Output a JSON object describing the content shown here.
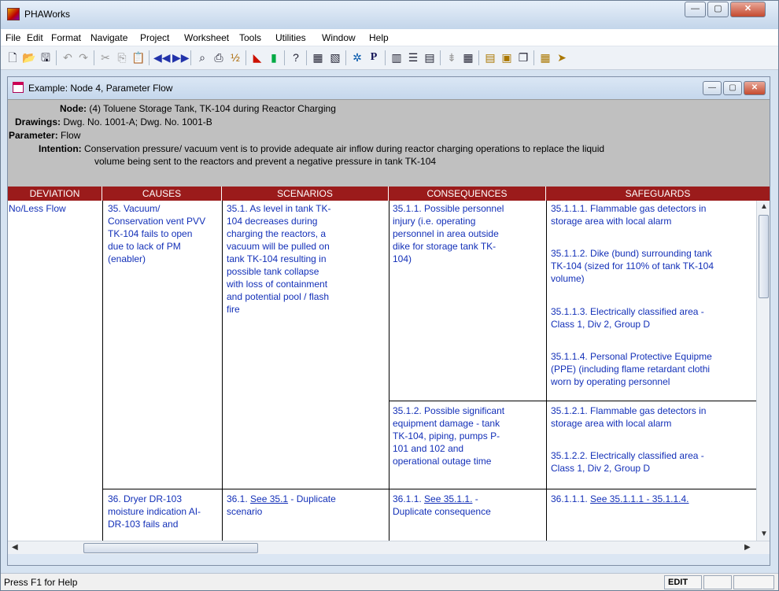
{
  "app": {
    "title": "PHAWorks",
    "min": "—",
    "max": "▢",
    "close": "✕"
  },
  "menu": [
    "File",
    "Edit",
    "Format",
    "Navigate",
    "Project",
    "Worksheet",
    "Tools",
    "Utilities",
    "Window",
    "Help"
  ],
  "toolbar_icons": [
    "new-icon",
    "open-icon",
    "save-icon",
    "undo-icon",
    "redo-icon",
    "cut-icon",
    "copy-icon",
    "paste-icon",
    "first-icon",
    "last-icon",
    "find-icon",
    "print-icon",
    "spell-icon",
    "chart-icon",
    "bars-icon",
    "help-icon"
  ],
  "window": {
    "title": "Example: Node 4, Parameter Flow",
    "min": "—",
    "max": "▢",
    "close": "✕"
  },
  "header": {
    "node_label": "Node:",
    "node_value": "(4) Toluene Storage Tank, TK-104 during Reactor Charging",
    "drawings_label": "Drawings:",
    "drawings_value": "Dwg. No. 1001-A; Dwg. No. 1001-B",
    "parameter_label": "Parameter:",
    "parameter_value": "Flow",
    "intention_label": "Intention:",
    "intention_line1": "Conservation pressure/ vacuum vent is to provide adequate air inflow during reactor charging operations to replace the liquid",
    "intention_line2": "volume being sent to the reactors and prevent a negative pressure in tank TK-104"
  },
  "columns": [
    "DEVIATION",
    "CAUSES",
    "SCENARIOS",
    "CONSEQUENCES",
    "SAFEGUARDS"
  ],
  "rows": {
    "deviation": "No/Less Flow",
    "cause35": "35. Vacuum/\nConservation vent PVV\nTK-104 fails to open\ndue to lack of PM\n(enabler)",
    "scenario351": "35.1. As level in tank TK-\n104 decreases during\ncharging the reactors, a\nvacuum will be pulled on\ntank TK-104 resulting in\npossible tank collapse\nwith loss of containment\nand potential pool / flash\nfire",
    "cons3511": "35.1.1. Possible personnel\ninjury (i.e. operating\npersonnel in area outside\ndike for storage tank TK-\n104)",
    "sg1": "35.1.1.1. Flammable gas detectors in\nstorage area with local alarm",
    "sg2": "35.1.1.2. Dike (bund) surrounding tank\nTK-104 (sized for 110% of tank TK-104\nvolume)",
    "sg3": "35.1.1.3. Electrically classified area -\nClass 1, Div 2, Group D",
    "sg4": "35.1.1.4. Personal Protective Equipme\n(PPE) (including flame retardant clothi\nworn by operating personnel",
    "cons3512": "35.1.2. Possible significant\nequipment damage - tank\nTK-104, piping, pumps P-\n101 and 102 and\noperational outage time",
    "sg5": "35.1.2.1. Flammable gas detectors in\nstorage area with local alarm",
    "sg6": "35.1.2.2. Electrically classified area -\nClass 1, Div 2, Group D",
    "cause36": "36. Dryer DR-103\nmoisture indication AI-\nDR-103 fails and",
    "scen361_pre": "36.1. ",
    "scen361_link": "See 35.1",
    "scen361_post": " - Duplicate\nscenario",
    "cons3611_pre": "36.1.1. ",
    "cons3611_link": "See 35.1.1.",
    "cons3611_post": " -\nDuplicate consequence",
    "sg7_pre": "36.1.1.1. ",
    "sg7_link": "See 35.1.1.1 - 35.1.1.4."
  },
  "status": {
    "help": "Press F1 for Help",
    "mode": "EDIT"
  }
}
